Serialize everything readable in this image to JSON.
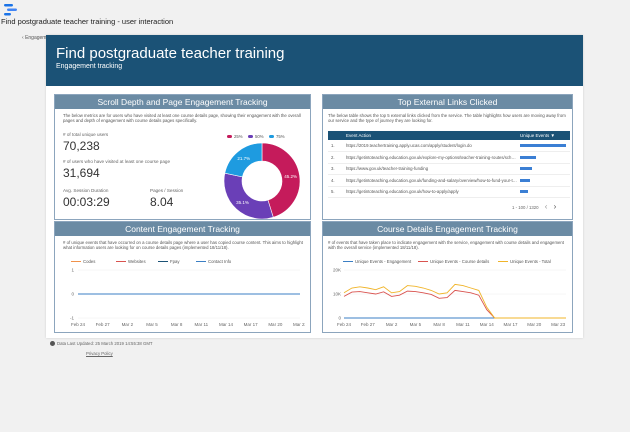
{
  "app": {
    "title": "Find postgraduate teacher training - user interaction",
    "back_link": "Engagement tracking",
    "footer_date": "Data Last Updated: 25 March 2019 14:55:38 GMT",
    "footer_privacy": "Privacy Policy"
  },
  "banner": {
    "title": "Find postgraduate teacher training",
    "subtitle": "Engagement tracking",
    "color": "#1b5276"
  },
  "scroll": {
    "title": "Scroll Depth and Page Engagement Tracking",
    "desc": "The below metrics are for users who have visited at least one course details page, showing their engagement with the overall pages and depth of engagement with course details pages specifically.",
    "total_users_label": "# of total unique users",
    "total_users": "70,238",
    "course_users_label": "# of users who have visited at least one course page",
    "course_users": "31,694",
    "avg_session_label": "Avg. Session Duration",
    "avg_session": "00:03:29",
    "pages_label": "Pages / Session",
    "pages": "8.04"
  },
  "donut": {
    "legend": [
      "25%",
      "50%",
      "75%"
    ],
    "labels": [
      "45.2%",
      "35.1%",
      "21.7%"
    ],
    "colors": [
      "#c51b5b",
      "#6a3fb7",
      "#1e9be0"
    ],
    "values": [
      45.2,
      33.1,
      21.7
    ]
  },
  "links": {
    "title": "Top External Links Clicked",
    "desc": "The below table shows the top 5 external links clicked from the service. The table highlights how users are moving away from our service and the type of journey they are looking for.",
    "col_action": "Event Action",
    "col_events": "Unique Events ▼",
    "pagination": "1 - 100 / 1320",
    "rows": [
      {
        "n": "1.",
        "url": "https://2019.teachertraining.apply.ucas.com/apply/student/login.do",
        "v": 100
      },
      {
        "n": "2.",
        "url": "https://getintoteaching.education.gov.uk/explore-my-options/teacher-training-routes/school-led-training-for-graduates",
        "v": 35
      },
      {
        "n": "3.",
        "url": "https://www.gov.uk/teacher-training-funding",
        "v": 25
      },
      {
        "n": "4.",
        "url": "https://getintoteaching.education.gov.uk/funding-and-salary/overview/how-to-fund-your-training",
        "v": 22
      },
      {
        "n": "5.",
        "url": "https://getintoteaching.education.gov.uk/how-to-apply/apply",
        "v": 18
      }
    ]
  },
  "content": {
    "title": "Content Engagement Tracking",
    "desc": "# of unique events that have occurred on a course details page where a user has copied course content. This aims to highlight what information users are looking for on course details pages (implemented 18/11/18).",
    "legend": [
      {
        "name": "Codes",
        "color": "#f0914a"
      },
      {
        "name": "Websites",
        "color": "#d9534f"
      },
      {
        "name": "Fpay",
        "color": "#1b5276"
      },
      {
        "name": "Contact Info",
        "color": "#3b7fc4"
      }
    ]
  },
  "course": {
    "title": "Course Details Engagement Tracking",
    "desc": "# of events that have taken place to indicate engagement with the service, engagement with course details and engagement with the overall service (implemented 18/11/18).",
    "legend": [
      {
        "name": "Unique Events - Engagement",
        "color": "#3b7fc4"
      },
      {
        "name": "Unique Events - Course details",
        "color": "#d9534f"
      },
      {
        "name": "Unique Events - Total",
        "color": "#f0b429"
      }
    ]
  },
  "chart_data": [
    {
      "type": "pie",
      "title": "",
      "categories": [
        "25%",
        "50%",
        "75%"
      ],
      "values": [
        45.2,
        33.1,
        21.7
      ]
    },
    {
      "type": "line",
      "title": "Content Engagement Tracking",
      "x": [
        "Feb 24",
        "Feb 27",
        "Mar 2",
        "Mar 5",
        "Mar 8",
        "Mar 11",
        "Mar 14",
        "Mar 17",
        "Mar 20",
        "Mar 23"
      ],
      "yticks": [
        "1",
        "0",
        "-1"
      ],
      "ylim": [
        -1,
        1
      ],
      "series": [
        {
          "name": "Codes",
          "values": [
            0,
            0,
            0,
            0,
            0,
            0,
            0,
            0,
            0,
            0
          ]
        },
        {
          "name": "Websites",
          "values": [
            0,
            0,
            0,
            0,
            0,
            0,
            0,
            0,
            0,
            0
          ]
        },
        {
          "name": "Fpay",
          "values": [
            0,
            0,
            0,
            0,
            0,
            0,
            0,
            0,
            0,
            0
          ]
        },
        {
          "name": "Contact Info",
          "values": [
            0,
            0,
            0,
            0,
            0,
            0,
            0,
            0,
            0,
            0
          ]
        }
      ]
    },
    {
      "type": "line",
      "title": "Course Details Engagement Tracking",
      "x": [
        "Feb 24",
        "Feb 25",
        "Feb 26",
        "Feb 27",
        "Feb 28",
        "Mar 1",
        "Mar 2",
        "Mar 3",
        "Mar 4",
        "Mar 5",
        "Mar 6",
        "Mar 7",
        "Mar 8",
        "Mar 9",
        "Mar 10",
        "Mar 11",
        "Mar 12",
        "Mar 13",
        "Mar 14",
        "Mar 15",
        "Mar 16",
        "Mar 17",
        "Mar 18",
        "Mar 19",
        "Mar 20",
        "Mar 21",
        "Mar 22",
        "Mar 23",
        "Mar 24"
      ],
      "xticks": [
        "Feb 24",
        "Feb 27",
        "Mar 2",
        "Mar 5",
        "Mar 8",
        "Mar 11",
        "Mar 14",
        "Mar 17",
        "Mar 20",
        "Mar 23"
      ],
      "yticks": [
        "20K",
        "10K",
        "0"
      ],
      "ylim": [
        0,
        20000
      ],
      "series": [
        {
          "name": "Unique Events - Engagement",
          "values": [
            0,
            0,
            0,
            0,
            0,
            0,
            0,
            0,
            0,
            0,
            0,
            0,
            0,
            0,
            0,
            0,
            0,
            0,
            0,
            0,
            0,
            0,
            0,
            0,
            0,
            0,
            0,
            0,
            0
          ]
        },
        {
          "name": "Unique Events - Course details",
          "values": [
            9000,
            10800,
            11000,
            10500,
            10000,
            10900,
            9000,
            9500,
            11200,
            11000,
            10500,
            9800,
            8200,
            8500,
            11500,
            11000,
            10500,
            9500,
            3500,
            0,
            0,
            0,
            0,
            0,
            0,
            0,
            0,
            0,
            0
          ]
        },
        {
          "name": "Unique Events - Total",
          "values": [
            10500,
            12500,
            13000,
            12500,
            11800,
            13000,
            10500,
            11000,
            13500,
            13200,
            12500,
            11500,
            10000,
            10500,
            14000,
            13500,
            12500,
            11500,
            4500,
            0,
            0,
            0,
            0,
            0,
            0,
            0,
            0,
            0,
            0
          ]
        }
      ]
    }
  ]
}
